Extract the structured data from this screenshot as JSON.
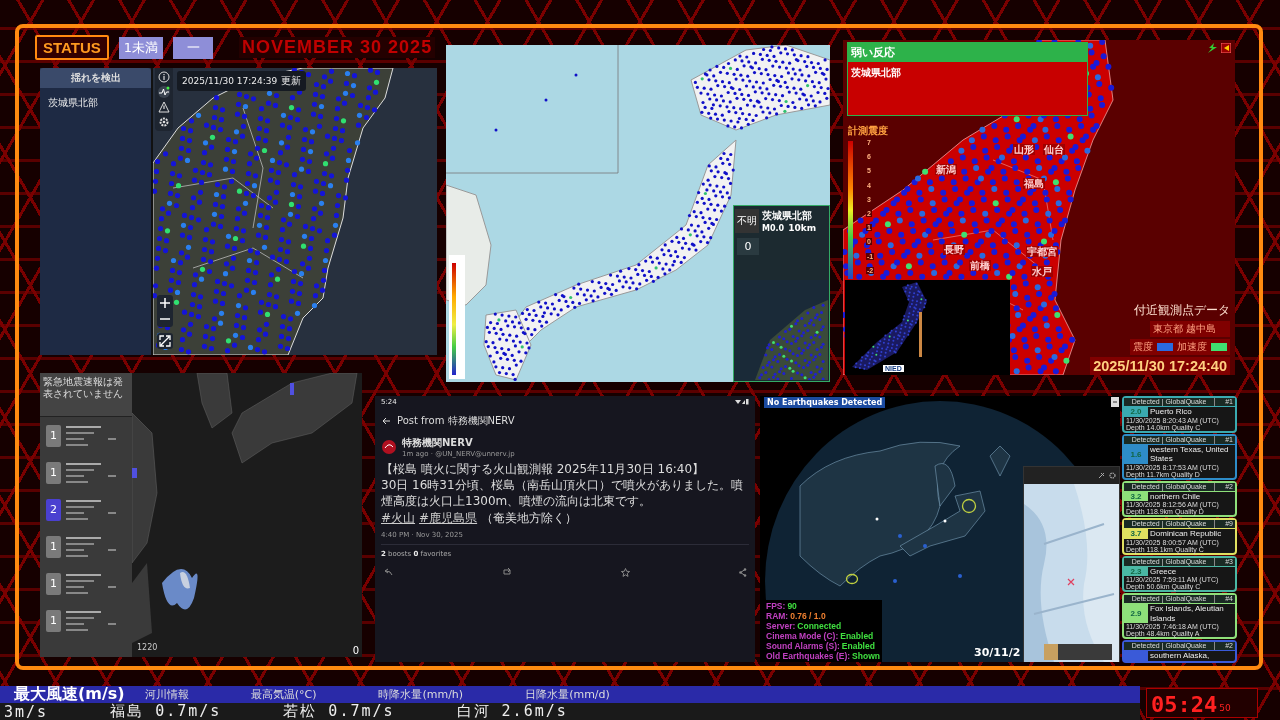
{
  "status": {
    "label": "STATUS",
    "intensity": "1未満",
    "level": "一",
    "date": "NOVEMBER 30 2025"
  },
  "detector": {
    "sidebar_title": "揺れを検出",
    "regions": [
      "茨城県北部"
    ],
    "timestamp": "2025/11/30 17:24:39",
    "updated_label": "更新"
  },
  "overview_map": {
    "inset": {
      "depth_status": "不明",
      "region": "茨城県北部",
      "magnitude": "M0.0",
      "depth": "10km",
      "intensity": "0"
    }
  },
  "intensity_map": {
    "alert_title": "弱い反応",
    "alert_regions": [
      "茨城県北部"
    ],
    "scale_title": "計測震度",
    "scale": [
      "7",
      "6",
      "5",
      "4",
      "3",
      "2",
      "1",
      "0",
      "-1",
      "-2"
    ],
    "cities": [
      "山形",
      "仙台",
      "新潟",
      "福島",
      "長野",
      "宇都宮",
      "前橋",
      "水戸"
    ],
    "nearby_title": "付近観測点データ",
    "station": "東京都 越中島",
    "legend": [
      {
        "label": "震度",
        "color": "#2a6ae0"
      },
      {
        "label": "加速度",
        "color": "#40e070"
      }
    ],
    "timestamp": "2025/11/30 17:24:40",
    "inset_logo": "NIED"
  },
  "radar": {
    "header": "緊急地震速報は発表されていません",
    "reports": [
      {
        "intensity": "1",
        "color": "#7a7a7a"
      },
      {
        "intensity": "1",
        "color": "#7a7a7a"
      },
      {
        "intensity": "2",
        "color": "#4a40d0"
      },
      {
        "intensity": "1",
        "color": "#7a7a7a"
      },
      {
        "intensity": "1",
        "color": "#7a7a7a"
      },
      {
        "intensity": "1",
        "color": "#7a7a7a"
      }
    ],
    "radar_time": "1220",
    "counter": "0"
  },
  "post": {
    "status_time": "5:24",
    "title": "Post from 特務機関NERV",
    "author": "特務機関NERV",
    "meta": "1m ago · @UN_NERV@unnerv.jp",
    "headline": "【桜島 噴火に関する火山観測報 2025年11月30日 16:40】",
    "body": "30日 16時31分頃、桜島（南岳山頂火口）で噴火がありました。噴煙高度は火口上1300m、噴煙の流向は北東です。",
    "hashtags": [
      "#火山",
      "#鹿児島県"
    ],
    "hashtag_suffix": "（奄美地方除く）",
    "date": "4:40 PM · Nov 30, 2025",
    "stats": "**2** boosts **0** favorites"
  },
  "globe": {
    "banner": "No Earthquakes Detected",
    "stats": [
      {
        "label": "FPS:",
        "value": "90",
        "color": "#40e040"
      },
      {
        "label": "RAM:",
        "value": "0.76 / 1.0",
        "color": "#f08030"
      },
      {
        "label": "Server:",
        "value": "Connected",
        "color": "#40e040"
      },
      {
        "label": "Cinema Mode (C):",
        "value": "Enabled",
        "color": "#40e040"
      },
      {
        "label": "Sound Alarms (S):",
        "value": "Enabled",
        "color": "#40e040"
      },
      {
        "label": "Old Earthquakes (E):",
        "value": "Shown",
        "color": "#40e040"
      }
    ],
    "date": "30/11/2"
  },
  "quakes": [
    {
      "source": "Detected | GlobalQuake",
      "rank": "#1",
      "magnitude": "2.0",
      "place": "Puerto Rico",
      "time": "11/30/2025 8:20:43 AM (UTC)",
      "details": "Depth 14.0km   Quality C",
      "color": "#3aaab0"
    },
    {
      "source": "Detected | GlobalQuake",
      "rank": "#1",
      "magnitude": "1.6",
      "place": "western Texas, United States",
      "time": "11/30/2025 8:17:53 AM (UTC)",
      "details": "Depth 11.7km   Quality D",
      "color": "#2e8cc8"
    },
    {
      "source": "Detected | GlobalQuake",
      "rank": "#2",
      "magnitude": "3.2",
      "place": "northern Chile",
      "time": "11/30/2025 8:12:56 AM (UTC)",
      "details": "Depth 118.9km   Quality D",
      "color": "#8ee07a"
    },
    {
      "source": "Detected | GlobalQuake",
      "rank": "#9",
      "magnitude": "3.7",
      "place": "Dominican Republic",
      "time": "11/30/2025 8:00:57 AM (UTC)",
      "details": "Depth 118.1km   Quality C",
      "color": "#e0e060"
    },
    {
      "source": "Detected | GlobalQuake",
      "rank": "#3",
      "magnitude": "2.3",
      "place": "Greece",
      "time": "11/30/2025 7:59:11 AM (UTC)",
      "details": "Depth 50.6km   Quality C",
      "color": "#4ab8a4"
    },
    {
      "source": "Detected | GlobalQuake",
      "rank": "#4",
      "magnitude": "2.9",
      "place": "Fox Islands, Aleutian Islands",
      "time": "11/30/2025 7:46:18 AM (UTC)",
      "details": "Depth 48.4km   Quality A",
      "color": "#8ee07a"
    },
    {
      "source": "Detected | GlobalQuake",
      "rank": "#2",
      "place": "southern Alaska,",
      "color": "#3a5ad8"
    }
  ],
  "ticker": {
    "headers": [
      "最大風速(m/s)",
      "河川情報",
      "最高気温(°C)",
      "時降水量(mm/h)",
      "日降水量(mm/d)"
    ],
    "items": [
      "3m/s",
      "福島 0.7m/s",
      "若松 0.7m/s",
      "白河 2.6m/s"
    ],
    "clock": "05:24",
    "seconds": "50"
  }
}
